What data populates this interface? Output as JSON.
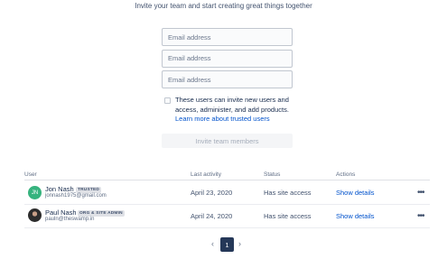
{
  "tagline": "Invite your team and start creating great things together",
  "invite_form": {
    "email_placeholders": [
      "Email address",
      "Email address",
      "Email address"
    ],
    "checkbox_label": "These users can invite new users and access, administer, and add products.",
    "learn_more_link": "Learn more about trusted users",
    "submit_label": "Invite team members"
  },
  "table": {
    "headers": [
      "User",
      "Last activity",
      "Status",
      "Actions"
    ],
    "rows": [
      {
        "avatar_initials": "JN",
        "name": "Jon Nash",
        "badge": "TRUSTED",
        "email": "jonnash1975@gmail.com",
        "last_activity": "April 23, 2020",
        "status": "Has site access",
        "action": "Show details",
        "more_label": "•••"
      },
      {
        "avatar_initials": "",
        "name": "Paul Nash",
        "badge": "ORG & SITE ADMIN",
        "email": "pauln@theswamp.in",
        "last_activity": "April 24, 2020",
        "status": "Has site access",
        "action": "Show details",
        "more_label": "•••"
      }
    ]
  },
  "pagination": {
    "prev": "‹",
    "current_page": "1",
    "next": "›"
  },
  "colors": {
    "link": "#0052cc",
    "avatar_green": "#36b37e",
    "active_page": "#253858"
  }
}
